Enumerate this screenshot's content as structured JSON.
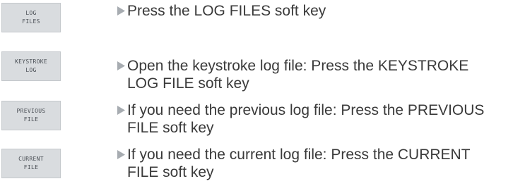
{
  "steps": [
    {
      "softkey": {
        "line1": "LOG",
        "line2": "FILES"
      },
      "text": "Press the LOG FILES soft key"
    },
    {
      "softkey": {
        "line1": "KEYSTROKE",
        "line2": "LOG"
      },
      "text": "Open the keystroke log file: Press the KEYSTROKE\nLOG FILE soft key"
    },
    {
      "softkey": {
        "line1": "PREVIOUS",
        "line2": "FILE"
      },
      "text": "If you need the previous log file: Press the PREVIOUS\nFILE soft key"
    },
    {
      "softkey": {
        "line1": "CURRENT",
        "line2": "FILE"
      },
      "text": "If you need the current log file: Press the CURRENT\nFILE soft key"
    }
  ],
  "icons": {
    "bullet": "triangle-right-icon",
    "bullet_color": "#a7acb1"
  },
  "colors": {
    "softkey_bg": "#d9dcdf",
    "softkey_text": "#4a4f55",
    "body_text": "#3a3a3a"
  }
}
